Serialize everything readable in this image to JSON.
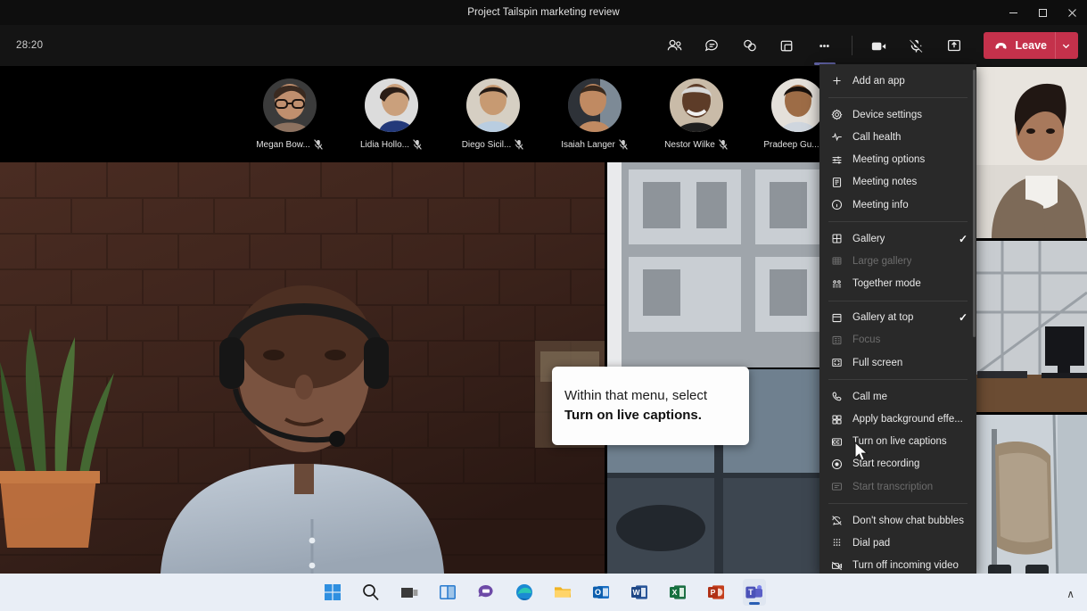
{
  "window": {
    "title": "Project Tailspin marketing review",
    "controls": [
      {
        "name": "minimize-button",
        "glyph": "–"
      },
      {
        "name": "maximize-button",
        "glyph": "□"
      },
      {
        "name": "close-button",
        "glyph": "✕"
      }
    ]
  },
  "toolbar": {
    "timer": "28:20",
    "buttons": [
      {
        "name": "people-button",
        "icon": "people-icon",
        "label": "People"
      },
      {
        "name": "chat-button",
        "icon": "chat-icon",
        "label": "Chat"
      },
      {
        "name": "reactions-button",
        "icon": "reactions-icon",
        "label": "React"
      },
      {
        "name": "breakout-rooms-button",
        "icon": "breakout-rooms-icon",
        "label": "Rooms"
      },
      {
        "name": "more-actions-button",
        "icon": "ellipsis-icon",
        "label": "More actions"
      },
      {
        "name": "camera-button",
        "icon": "camera-icon",
        "label": "Camera"
      },
      {
        "name": "mic-button",
        "icon": "mic-muted-icon",
        "label": "Mic muted"
      },
      {
        "name": "share-button",
        "icon": "share-screen-icon",
        "label": "Share"
      }
    ],
    "leave_label": "Leave",
    "leave_color": "#c4314b",
    "accent_color": "#6264a7"
  },
  "gallery": {
    "participants": [
      {
        "name": "Megan Bow...",
        "muted": true
      },
      {
        "name": "Lidia Hollo...",
        "muted": true
      },
      {
        "name": "Diego Sicil...",
        "muted": true
      },
      {
        "name": "Isaiah Langer",
        "muted": true
      },
      {
        "name": "Nestor Wilke",
        "muted": true
      },
      {
        "name": "Pradeep Gu...",
        "muted": true
      }
    ]
  },
  "menu": {
    "items": [
      {
        "id": "add-an-app",
        "label": "Add an app",
        "icon": "plus-icon",
        "disabled": false,
        "checked": false,
        "sep_after": true
      },
      {
        "id": "device-settings",
        "label": "Device settings",
        "icon": "gear-icon",
        "disabled": false,
        "checked": false,
        "sep_after": false
      },
      {
        "id": "call-health",
        "label": "Call health",
        "icon": "pulse-icon",
        "disabled": false,
        "checked": false,
        "sep_after": false
      },
      {
        "id": "meeting-options",
        "label": "Meeting options",
        "icon": "sliders-icon",
        "disabled": false,
        "checked": false,
        "sep_after": false
      },
      {
        "id": "meeting-notes",
        "label": "Meeting notes",
        "icon": "notes-icon",
        "disabled": false,
        "checked": false,
        "sep_after": false
      },
      {
        "id": "meeting-info",
        "label": "Meeting info",
        "icon": "info-icon",
        "disabled": false,
        "checked": false,
        "sep_after": true
      },
      {
        "id": "gallery",
        "label": "Gallery",
        "icon": "grid-icon",
        "disabled": false,
        "checked": true,
        "sep_after": false
      },
      {
        "id": "large-gallery",
        "label": "Large gallery",
        "icon": "large-grid-icon",
        "disabled": true,
        "checked": false,
        "sep_after": false
      },
      {
        "id": "together-mode",
        "label": "Together mode",
        "icon": "together-icon",
        "disabled": false,
        "checked": false,
        "sep_after": true
      },
      {
        "id": "gallery-at-top",
        "label": "Gallery at top",
        "icon": "gallery-top-icon",
        "disabled": false,
        "checked": true,
        "sep_after": false
      },
      {
        "id": "focus",
        "label": "Focus",
        "icon": "focus-icon",
        "disabled": true,
        "checked": false,
        "sep_after": false
      },
      {
        "id": "full-screen",
        "label": "Full screen",
        "icon": "fullscreen-icon",
        "disabled": false,
        "checked": false,
        "sep_after": true
      },
      {
        "id": "call-me",
        "label": "Call me",
        "icon": "phone-icon",
        "disabled": false,
        "checked": false,
        "sep_after": false
      },
      {
        "id": "apply-background",
        "label": "Apply background effe...",
        "icon": "background-icon",
        "disabled": false,
        "checked": false,
        "sep_after": false
      },
      {
        "id": "turn-on-live-captions",
        "label": "Turn on live captions",
        "icon": "captions-icon",
        "disabled": false,
        "checked": false,
        "sep_after": false
      },
      {
        "id": "start-recording",
        "label": "Start recording",
        "icon": "record-icon",
        "disabled": false,
        "checked": false,
        "sep_after": false
      },
      {
        "id": "start-transcription",
        "label": "Start transcription",
        "icon": "transcription-icon",
        "disabled": true,
        "checked": false,
        "sep_after": true
      },
      {
        "id": "dont-show-chat-bubbles",
        "label": "Don't show chat bubbles",
        "icon": "chat-bubble-off-icon",
        "disabled": false,
        "checked": false,
        "sep_after": false
      },
      {
        "id": "dial-pad",
        "label": "Dial pad",
        "icon": "dialpad-icon",
        "disabled": false,
        "checked": false,
        "sep_after": false
      },
      {
        "id": "turn-off-incoming-video",
        "label": "Turn off incoming video",
        "icon": "video-off-icon",
        "disabled": false,
        "checked": false,
        "sep_after": false
      }
    ]
  },
  "callout": {
    "line1": "Within that menu, select",
    "line2": "Turn on live captions."
  },
  "taskbar": {
    "items": [
      {
        "name": "start-button",
        "icon": "windows-start-icon",
        "active": false
      },
      {
        "name": "search-button",
        "icon": "search-icon",
        "active": false
      },
      {
        "name": "task-view-button",
        "icon": "task-view-icon",
        "active": false
      },
      {
        "name": "widgets-button",
        "icon": "widgets-icon",
        "active": false
      },
      {
        "name": "chat-button",
        "icon": "teams-chat-icon",
        "active": false
      },
      {
        "name": "edge-button",
        "icon": "edge-icon",
        "active": false
      },
      {
        "name": "file-explorer-button",
        "icon": "file-explorer-icon",
        "active": false
      },
      {
        "name": "outlook-button",
        "icon": "outlook-icon",
        "active": false
      },
      {
        "name": "word-button",
        "icon": "word-icon",
        "active": false
      },
      {
        "name": "excel-button",
        "icon": "excel-icon",
        "active": false
      },
      {
        "name": "powerpoint-button",
        "icon": "powerpoint-icon",
        "active": false
      },
      {
        "name": "teams-button",
        "icon": "teams-icon",
        "active": true
      }
    ],
    "show_hidden_glyph": "∧"
  }
}
